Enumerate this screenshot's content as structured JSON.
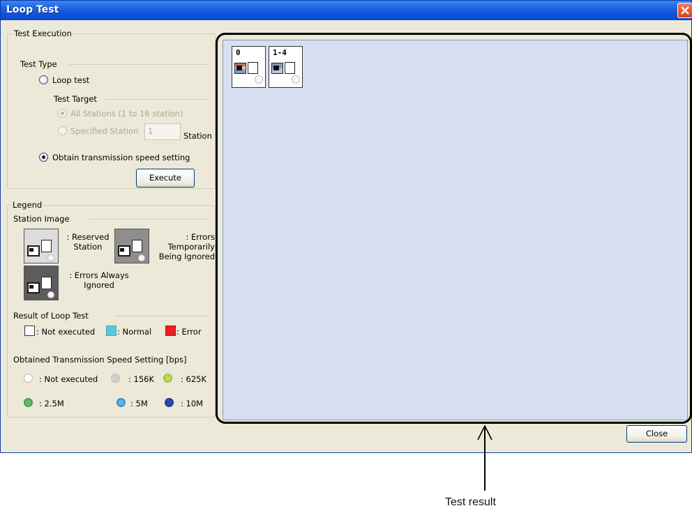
{
  "window": {
    "title": "Loop Test"
  },
  "test_execution": {
    "group_label": "Test Execution",
    "test_type_label": "Test Type",
    "loop_test_label": "Loop test",
    "test_target_label": "Test Target",
    "all_stations_label": "All Stations (1 to 16 station)",
    "specified_station_label": "Specified Station",
    "station_value": "1",
    "station_suffix": "Station",
    "obtain_speed_label": "Obtain transmission speed setting",
    "execute_label": "Execute"
  },
  "legend": {
    "group_label": "Legend",
    "station_image_label": "Station Image",
    "reserved_label": ": Reserved Station",
    "errors_temp_label": ": Errors Temporarily Being Ignored",
    "errors_always_label": ": Errors Always Ignored",
    "result_label": "Result of Loop Test",
    "not_executed_label": ": Not executed",
    "normal_label": ": Normal",
    "error_label": ": Error",
    "speed_label": "Obtained Transmission Speed Setting [bps]",
    "speed_items": [
      {
        "label": ": Not executed",
        "color": "#ffffff"
      },
      {
        "label": ": 156K",
        "color": "#c8c8c8"
      },
      {
        "label": ": 625K",
        "color": "#b8d85a"
      },
      {
        "label": ": 2.5M",
        "color": "#6ab86a"
      },
      {
        "label": ": 5M",
        "color": "#4aa8e0"
      },
      {
        "label": ": 10M",
        "color": "#2a4aa8"
      }
    ]
  },
  "result": {
    "stations": [
      {
        "label": "0"
      },
      {
        "label": "1-4"
      }
    ]
  },
  "close_label": "Close",
  "annotation": "Test result",
  "colors": {
    "normal": "#5bc8d8",
    "error": "#e82020",
    "result_bg": "#d6e0f0"
  }
}
